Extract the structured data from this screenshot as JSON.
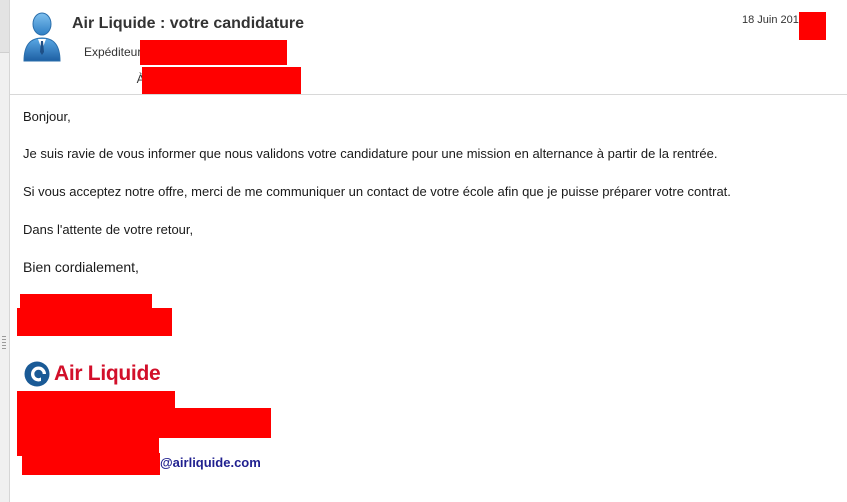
{
  "email": {
    "subject": "Air Liquide : votre candidature",
    "from_label": "Expéditeur :",
    "to_label": "À:",
    "date": "18 Juin 2019"
  },
  "body": {
    "greeting": "Bonjour,",
    "paragraph_1": "Je suis ravie de vous informer que nous validons votre candidature  pour une mission en alternance à partir de la rentrée.",
    "paragraph_2": "Si vous acceptez notre offre, merci de me communiquer un contact de votre école afin que je puisse préparer votre contrat.",
    "closing_1": "Dans l'attente de votre retour,",
    "closing_2": "Bien cordialement,"
  },
  "signature": {
    "company_logo_text": "Air Liquide",
    "email_domain": "@airliquide.com"
  },
  "colors": {
    "redaction": "#ff0000",
    "brand_red": "#d20f2a",
    "brand_blue": "#1a5a96",
    "email_link": "#1f1f8f"
  },
  "icons": {
    "sender_avatar": "person-avatar-icon",
    "logo_mark": "air-liquide-logo-icon"
  }
}
